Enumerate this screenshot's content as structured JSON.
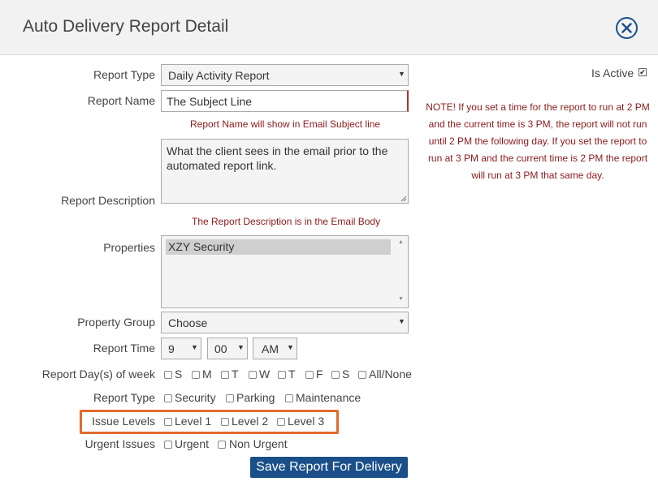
{
  "dialog": {
    "title": "Auto Delivery Report Detail",
    "close_icon": "close-circle-icon"
  },
  "form": {
    "report_type": {
      "label": "Report Type",
      "value": "Daily Activity Report"
    },
    "report_name": {
      "label": "Report Name",
      "value": "The Subject Line",
      "hint": "Report Name will show in Email Subject line"
    },
    "report_description": {
      "label": "Report Description",
      "value": "What the client sees in the email prior to the automated report link.",
      "hint": "The Report Description is in the Email Body"
    },
    "properties": {
      "label": "Properties",
      "items": [
        "XZY Security"
      ]
    },
    "property_group": {
      "label": "Property Group",
      "value": "Choose"
    },
    "report_time": {
      "label": "Report Time",
      "hour": "9",
      "minute": "00",
      "ampm": "AM"
    },
    "report_days": {
      "label": "Report Day(s) of week",
      "options": [
        "S",
        "M",
        "T",
        "W",
        "T",
        "F",
        "S",
        "All/None"
      ]
    },
    "report_type_filter": {
      "label": "Report Type",
      "options": [
        "Security",
        "Parking",
        "Maintenance"
      ]
    },
    "issue_levels": {
      "label": "Issue Levels",
      "options": [
        "Level 1",
        "Level 2",
        "Level 3"
      ]
    },
    "urgent_issues": {
      "label": "Urgent Issues",
      "options": [
        "Urgent",
        "Non Urgent"
      ]
    }
  },
  "side": {
    "is_active_label": "Is Active",
    "is_active_checked": true,
    "note": "NOTE! If you set a time for the report to run at 2 PM and the current time is 3 PM, the report will not run until 2 PM the following day. If you set the report to run at 3 PM and the current time is 2 PM the report will run at 3 PM that same day."
  },
  "actions": {
    "save_label": "Save Report For Delivery"
  },
  "colors": {
    "accent": "#1a4f8a",
    "warning_text": "#8b1a1a",
    "highlight": "#e26a2c"
  }
}
